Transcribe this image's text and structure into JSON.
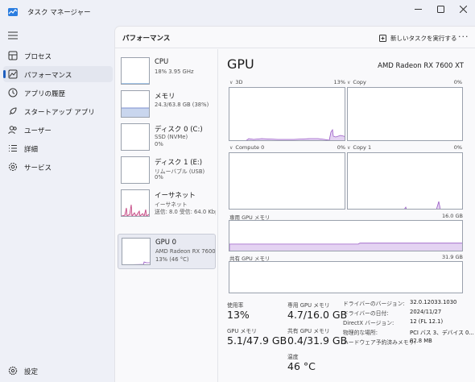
{
  "window": {
    "title": "タスク マネージャー"
  },
  "sidebar": {
    "items": [
      {
        "label": "プロセス",
        "icon": "processes-icon"
      },
      {
        "label": "パフォーマンス",
        "icon": "performance-icon"
      },
      {
        "label": "アプリの履歴",
        "icon": "app-history-icon"
      },
      {
        "label": "スタートアップ アプリ",
        "icon": "startup-apps-icon"
      },
      {
        "label": "ユーザー",
        "icon": "users-icon"
      },
      {
        "label": "詳細",
        "icon": "details-icon"
      },
      {
        "label": "サービス",
        "icon": "services-icon"
      }
    ],
    "active_index": 1,
    "settings_label": "設定"
  },
  "header": {
    "title": "パフォーマンス",
    "new_task": "新しいタスクを実行する",
    "more": "···"
  },
  "devices": [
    {
      "name": "CPU",
      "line1": "18%  3.95 GHz",
      "line2": ""
    },
    {
      "name": "メモリ",
      "line1": "24.3/63.8 GB (38%)",
      "line2": ""
    },
    {
      "name": "ディスク 0 (C:)",
      "line1": "SSD (NVMe)",
      "line2": "0%"
    },
    {
      "name": "ディスク 1 (E:)",
      "line1": "リムーバブル (USB)",
      "line2": "0%"
    },
    {
      "name": "イーサネット",
      "line1": "イーサネット",
      "line2": "送信: 8.0  受信: 64.0 Kbps"
    },
    {
      "name": "GPU 0",
      "line1": "AMD Radeon RX 7600 XT",
      "line2": "13% (46 °C)"
    }
  ],
  "gpu": {
    "title": "GPU",
    "model": "AMD Radeon RX 7600 XT",
    "graphs": [
      {
        "label": "3D",
        "pct": "13%"
      },
      {
        "label": "Copy",
        "pct": "0%"
      },
      {
        "label": "Compute 0",
        "pct": "0%"
      },
      {
        "label": "Copy 1",
        "pct": "0%"
      }
    ],
    "dedicated": {
      "label": "専用 GPU メモリ",
      "max": "16.0 GB",
      "fill_fraction": 0.29
    },
    "shared": {
      "label": "共有 GPU メモリ",
      "max": "31.9 GB",
      "fill_fraction": 0.013
    },
    "stats": {
      "usage_label": "使用率",
      "usage": "13%",
      "dedicated_label": "専用 GPU メモリ",
      "dedicated": "4.7/16.0 GB",
      "gpu_mem_label": "GPU メモリ",
      "gpu_mem": "5.1/47.9 GB",
      "shared_label": "共有 GPU メモリ",
      "shared": "0.4/31.9 GB",
      "temp_label": "温度",
      "temp": "46 °C"
    },
    "info": [
      {
        "key": "ドライバーのバージョン:",
        "value": "32.0.12033.1030"
      },
      {
        "key": "ドライバーの日付:",
        "value": "2024/11/27"
      },
      {
        "key": "DirectX バージョン:",
        "value": "12 (FL 12.1)"
      },
      {
        "key": "物理的な場所:",
        "value": "PCI バス 3、デバイス 0..."
      },
      {
        "key": "ハードウェア予約済みメモリ:",
        "value": "82.8 MB"
      }
    ]
  },
  "colors": {
    "accent": "#1f5fbf",
    "gpu_line": "#9a5cc6",
    "gpu_fill": "#e4d3f2",
    "mem_line": "#7d8fd0",
    "mem_fill": "#c9d6ee",
    "eth_line": "#c0397a"
  }
}
